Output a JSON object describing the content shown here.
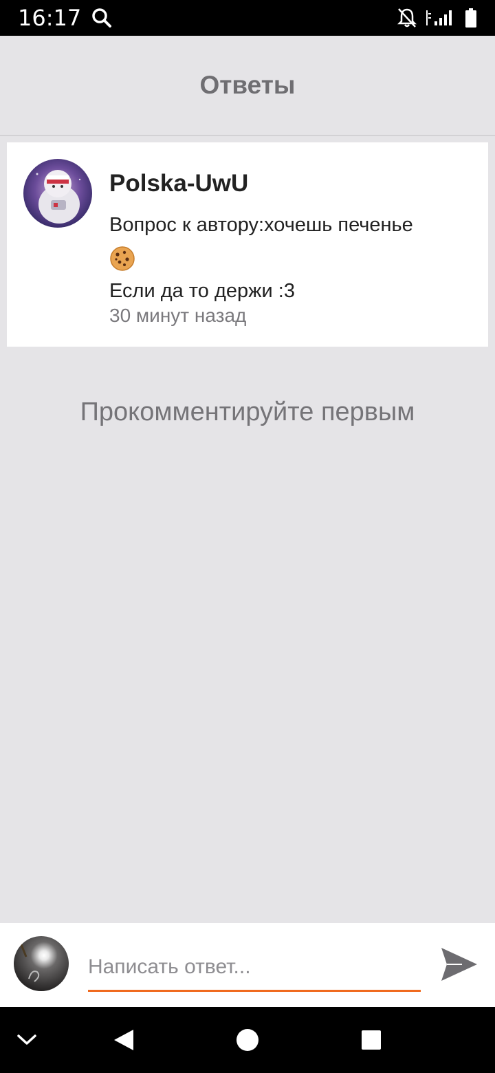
{
  "status_bar": {
    "time": "16:17",
    "icons": [
      "search-icon",
      "notifications-off-icon",
      "signal-icon",
      "battery-icon"
    ]
  },
  "header": {
    "title": "Ответы"
  },
  "post": {
    "author": "Polska-UwU",
    "line1": "Вопрос к автору:хочешь печенье",
    "emoji": "cookie-emoji",
    "line3": "Если да то держи :3",
    "time": "30 минут назад"
  },
  "comments": {
    "empty_text": "Прокомментируйте первым"
  },
  "reply": {
    "placeholder": "Написать ответ...",
    "value": "",
    "accent_color": "#f06a1e"
  },
  "nav_bar": {
    "icons": [
      "chevron-down-icon",
      "back-icon",
      "home-icon",
      "recents-icon"
    ]
  }
}
